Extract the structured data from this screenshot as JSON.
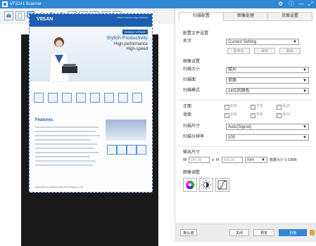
{
  "window": {
    "title": "VF3241 Scanner",
    "controls": [
      "⚙",
      "ⓘ",
      "—",
      "⤢"
    ]
  },
  "tabs": [
    {
      "label": "扫描配置",
      "active": true
    },
    {
      "label": "图像处理",
      "active": false
    },
    {
      "label": "页面设置",
      "active": false
    }
  ],
  "profile": {
    "section_label": "配置文件设置",
    "name_label": "名字",
    "name_value": "Current Setting",
    "rename_btn": "重命名",
    "save_btn": "保存",
    "delete_btn": "删除"
  },
  "image_settings": {
    "section_label": "图像设置",
    "rows": [
      {
        "label": "扫描大小",
        "value": "照片"
      },
      {
        "label": "扫描面",
        "value": "单面"
      },
      {
        "label": "扫描模式",
        "value": "24位的颜色"
      }
    ]
  },
  "color_filter": {
    "front_label": "正面",
    "back_label": "背面",
    "options": [
      "彩色",
      "灰色",
      "黑/白"
    ]
  },
  "scan_size": {
    "label": "扫描尺寸",
    "value": "Auto(Signal)"
  },
  "resolution": {
    "label": "扫描分辨率",
    "value": "100"
  },
  "output_size": {
    "section_label": "输出尺寸",
    "w_label": "W",
    "w_value": "297.00",
    "x_label": "x",
    "h_label": "H",
    "h_value": "420.00",
    "unit": "mm",
    "data_size": "数据大小 5.53MB"
  },
  "adjust": {
    "section_label": "图像调整"
  },
  "bottom": {
    "default_btn": "默认值",
    "close_btn": "关闭",
    "preview_btn": "预览",
    "scan_btn": "扫描"
  },
  "document": {
    "brand": "VIISAN",
    "header_tag": "VIISAN Scanner\nImage Solutions",
    "model": "VIISAN / VF3241",
    "slogan1": "Stylish Productivity",
    "slogan2": "High-performance",
    "slogan3": "High-speed",
    "features_title": "Features",
    "footer": "www.viisan.com     Beijing Viisan Technology Co., Ltd."
  },
  "colors": {
    "accent": "#2f88d6",
    "titlebar": "#2f88d6",
    "scan_bg": "#1a1a1a"
  }
}
